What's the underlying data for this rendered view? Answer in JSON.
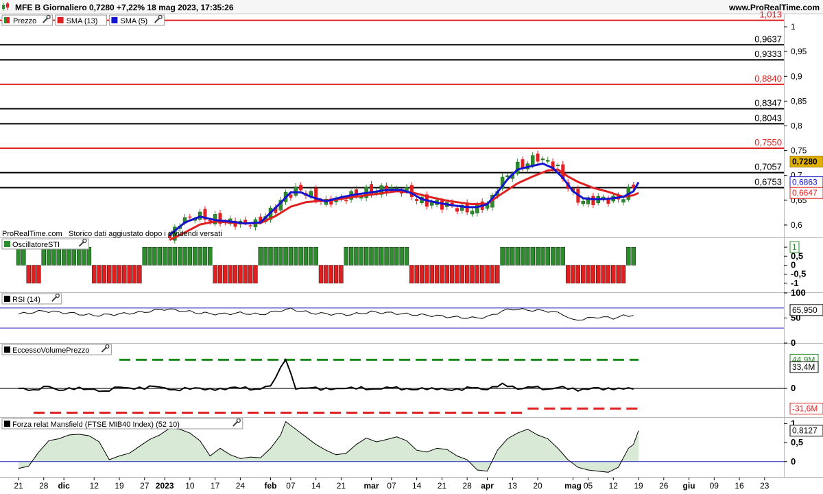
{
  "header": {
    "title": "MFE B Giornaliero 0,7280 +7,22% 18 mag 2023, 17:35:26",
    "brand": "www.ProRealTime.com"
  },
  "watermark": "ProRealTime.com",
  "note": "Storico dati aggiustato dopo i dividendi versati",
  "colors": {
    "up": "#2e8b2e",
    "down": "#e02020",
    "sma13": "#e02020",
    "sma5": "#1414d0",
    "red_level": "#e02020",
    "black_level": "#000000",
    "price_tag_bg": "#e0b000",
    "mansfield_fill": "#d8ead6"
  },
  "panels": {
    "price": {
      "legend": [
        {
          "label": "Prezzo",
          "icon": "candlestick-icon",
          "tool": true
        },
        {
          "label": "SMA (13)",
          "color": "#e02020",
          "tool": false
        },
        {
          "label": "SMA (5)",
          "color": "#1414d0",
          "tool": true
        }
      ],
      "ticks": [
        "1",
        "0,95",
        "0,9",
        "0,85",
        "0,8",
        "0,75",
        "0,7",
        "0,65",
        "0,6"
      ],
      "tick_values": [
        1,
        0.95,
        0.9,
        0.85,
        0.8,
        0.75,
        0.7,
        0.65,
        0.6
      ],
      "ylim": [
        0.575,
        1.025
      ],
      "levels": [
        {
          "value": 1.013,
          "label": "1,013",
          "color": "#e02020"
        },
        {
          "value": 0.9637,
          "label": "0,9637",
          "color": "#000000"
        },
        {
          "value": 0.9333,
          "label": "0,9333",
          "color": "#000000"
        },
        {
          "value": 0.884,
          "label": "0,8840",
          "color": "#e02020"
        },
        {
          "value": 0.8347,
          "label": "0,8347",
          "color": "#000000"
        },
        {
          "value": 0.8043,
          "label": "0,8043",
          "color": "#000000"
        },
        {
          "value": 0.755,
          "label": "0,7550",
          "color": "#e02020"
        },
        {
          "value": 0.7057,
          "label": "0,7057",
          "color": "#000000"
        },
        {
          "value": 0.6753,
          "label": "0,6753",
          "color": "#000000"
        }
      ],
      "tags": [
        {
          "value": 0.728,
          "label": "0,7280",
          "bg": "#e0b000",
          "fg": "#000000",
          "bold": true
        },
        {
          "value": 0.6863,
          "label": "0,6863",
          "bg": "#ffffff",
          "fg": "#1414d0",
          "bold": false
        },
        {
          "value": 0.6647,
          "label": "0,6647",
          "bg": "#ffffff",
          "fg": "#e02020",
          "bold": false
        }
      ]
    },
    "sti": {
      "title": "OscillatoreSTI",
      "ticks": [
        "1",
        "0,5",
        "0",
        "-0,5",
        "-1"
      ],
      "tick_values": [
        1,
        0.5,
        0,
        -0.5,
        -1
      ],
      "ylim": [
        -1.5,
        1.5
      ],
      "tag": "1"
    },
    "rsi": {
      "title": "RSI (14)",
      "ticks": [
        "100",
        "50",
        "0"
      ],
      "tick_values": [
        100,
        50,
        0
      ],
      "ylim": [
        0,
        100
      ],
      "bands": [
        70,
        30
      ],
      "tag": "65,950"
    },
    "volume": {
      "title": "EccessoVolumePrezzo",
      "ticks": [
        "0"
      ],
      "tick_values": [
        0
      ],
      "ylim": [
        -45,
        70
      ],
      "tags": [
        {
          "value": 44.9,
          "label": "44,9M",
          "fg": "#2e8b2e",
          "bg": "#ffffff"
        },
        {
          "value": 33.4,
          "label": "33,4M",
          "fg": "#000000",
          "bg": "#ffffff"
        },
        {
          "value": -31.6,
          "label": "-31,6M",
          "fg": "#e02020",
          "bg": "#ffffff"
        }
      ]
    },
    "mansfield": {
      "title": "Forza relat Mansfield (FTSE MIB40 Index) (52 10)",
      "ticks": [
        "1",
        "0,5",
        "0"
      ],
      "tick_values": [
        1,
        0.5,
        0
      ],
      "ylim": [
        -0.4,
        1.15
      ],
      "tag": "0,8127"
    }
  },
  "x_axis": {
    "labels": [
      {
        "i": 0,
        "text": "21",
        "bold": false
      },
      {
        "i": 5,
        "text": "28",
        "bold": false
      },
      {
        "i": 9,
        "text": "dic",
        "bold": true
      },
      {
        "i": 15,
        "text": "12",
        "bold": false
      },
      {
        "i": 20,
        "text": "19",
        "bold": false
      },
      {
        "i": 25,
        "text": "27",
        "bold": false
      },
      {
        "i": 29,
        "text": "2023",
        "bold": true
      },
      {
        "i": 34,
        "text": "10",
        "bold": false
      },
      {
        "i": 39,
        "text": "17",
        "bold": false
      },
      {
        "i": 44,
        "text": "24",
        "bold": false
      },
      {
        "i": 50,
        "text": "feb",
        "bold": true
      },
      {
        "i": 54,
        "text": "07",
        "bold": false
      },
      {
        "i": 59,
        "text": "14",
        "bold": false
      },
      {
        "i": 64,
        "text": "21",
        "bold": false
      },
      {
        "i": 70,
        "text": "mar",
        "bold": true
      },
      {
        "i": 74,
        "text": "07",
        "bold": false
      },
      {
        "i": 79,
        "text": "14",
        "bold": false
      },
      {
        "i": 84,
        "text": "21",
        "bold": false
      },
      {
        "i": 89,
        "text": "28",
        "bold": false
      },
      {
        "i": 93,
        "text": "apr",
        "bold": true
      },
      {
        "i": 98,
        "text": "13",
        "bold": false
      },
      {
        "i": 103,
        "text": "20",
        "bold": false
      },
      {
        "i": 110,
        "text": "mag",
        "bold": true
      },
      {
        "i": 113,
        "text": "05",
        "bold": false
      },
      {
        "i": 118,
        "text": "12",
        "bold": false
      },
      {
        "i": 123,
        "text": "19",
        "bold": false
      },
      {
        "i": 128,
        "text": "26",
        "bold": false
      },
      {
        "i": 133,
        "text": "giu",
        "bold": true
      },
      {
        "i": 138,
        "text": "09",
        "bold": false
      },
      {
        "i": 143,
        "text": "16",
        "bold": false
      },
      {
        "i": 148,
        "text": "23",
        "bold": false
      }
    ]
  },
  "chart_data": {
    "type": "candlestick",
    "title": "MFE B Giornaliero",
    "series_names": [
      "Prezzo",
      "SMA (13)",
      "SMA (5)"
    ],
    "x_start_label": "21",
    "bar_count": 123,
    "close_points": [
      [
        30,
        0.575
      ],
      [
        32,
        0.605
      ],
      [
        35,
        0.618
      ],
      [
        37,
        0.613
      ],
      [
        40,
        0.608
      ],
      [
        42,
        0.604
      ],
      [
        45,
        0.603
      ],
      [
        47,
        0.604
      ],
      [
        49,
        0.62
      ],
      [
        51,
        0.635
      ],
      [
        53,
        0.662
      ],
      [
        55,
        0.672
      ],
      [
        57,
        0.668
      ],
      [
        59,
        0.654
      ],
      [
        61,
        0.646
      ],
      [
        63,
        0.65
      ],
      [
        65,
        0.655
      ],
      [
        67,
        0.66
      ],
      [
        69,
        0.665
      ],
      [
        71,
        0.668
      ],
      [
        73,
        0.672
      ],
      [
        75,
        0.671
      ],
      [
        77,
        0.669
      ],
      [
        79,
        0.652
      ],
      [
        81,
        0.647
      ],
      [
        83,
        0.645
      ],
      [
        85,
        0.641
      ],
      [
        87,
        0.637
      ],
      [
        89,
        0.629
      ],
      [
        91,
        0.636
      ],
      [
        93,
        0.638
      ],
      [
        95,
        0.675
      ],
      [
        97,
        0.7
      ],
      [
        99,
        0.715
      ],
      [
        101,
        0.725
      ],
      [
        103,
        0.735
      ],
      [
        105,
        0.726
      ],
      [
        107,
        0.715
      ],
      [
        108,
        0.695
      ],
      [
        110,
        0.66
      ],
      [
        112,
        0.648
      ],
      [
        114,
        0.652
      ],
      [
        116,
        0.655
      ],
      [
        118,
        0.652
      ],
      [
        120,
        0.657
      ],
      [
        122,
        0.68
      ],
      [
        123,
        0.728
      ]
    ],
    "sma13_points": [
      [
        30,
        0.57
      ],
      [
        33,
        0.585
      ],
      [
        36,
        0.601
      ],
      [
        39,
        0.607
      ],
      [
        42,
        0.605
      ],
      [
        45,
        0.603
      ],
      [
        48,
        0.604
      ],
      [
        51,
        0.618
      ],
      [
        54,
        0.637
      ],
      [
        57,
        0.646
      ],
      [
        60,
        0.649
      ],
      [
        63,
        0.651
      ],
      [
        66,
        0.656
      ],
      [
        69,
        0.66
      ],
      [
        72,
        0.664
      ],
      [
        75,
        0.668
      ],
      [
        78,
        0.666
      ],
      [
        81,
        0.658
      ],
      [
        84,
        0.651
      ],
      [
        87,
        0.646
      ],
      [
        90,
        0.642
      ],
      [
        93,
        0.643
      ],
      [
        96,
        0.664
      ],
      [
        99,
        0.684
      ],
      [
        102,
        0.698
      ],
      [
        105,
        0.71
      ],
      [
        107,
        0.712
      ],
      [
        109,
        0.698
      ],
      [
        111,
        0.687
      ],
      [
        114,
        0.675
      ],
      [
        117,
        0.667
      ],
      [
        120,
        0.657
      ],
      [
        122,
        0.66
      ],
      [
        123,
        0.6647
      ]
    ],
    "sma5_points": [
      [
        30,
        0.58
      ],
      [
        33,
        0.605
      ],
      [
        36,
        0.617
      ],
      [
        39,
        0.61
      ],
      [
        42,
        0.607
      ],
      [
        45,
        0.603
      ],
      [
        48,
        0.605
      ],
      [
        50,
        0.625
      ],
      [
        52,
        0.645
      ],
      [
        54,
        0.666
      ],
      [
        56,
        0.666
      ],
      [
        58,
        0.657
      ],
      [
        61,
        0.648
      ],
      [
        64,
        0.656
      ],
      [
        67,
        0.662
      ],
      [
        70,
        0.666
      ],
      [
        73,
        0.671
      ],
      [
        76,
        0.671
      ],
      [
        78,
        0.664
      ],
      [
        80,
        0.652
      ],
      [
        83,
        0.645
      ],
      [
        86,
        0.64
      ],
      [
        89,
        0.636
      ],
      [
        91,
        0.636
      ],
      [
        93,
        0.642
      ],
      [
        95,
        0.666
      ],
      [
        97,
        0.692
      ],
      [
        99,
        0.712
      ],
      [
        101,
        0.717
      ],
      [
        104,
        0.724
      ],
      [
        106,
        0.715
      ],
      [
        108,
        0.695
      ],
      [
        110,
        0.668
      ],
      [
        112,
        0.654
      ],
      [
        114,
        0.652
      ],
      [
        116,
        0.652
      ],
      [
        118,
        0.654
      ],
      [
        120,
        0.657
      ],
      [
        122,
        0.668
      ],
      [
        123,
        0.6863
      ]
    ],
    "sti_states": [
      [
        0,
        1
      ],
      [
        2,
        -1
      ],
      [
        5,
        1
      ],
      [
        15,
        -1
      ],
      [
        25,
        1
      ],
      [
        39,
        -1
      ],
      [
        48,
        1
      ],
      [
        60,
        -1
      ],
      [
        65,
        1
      ],
      [
        78,
        -1
      ],
      [
        96,
        1
      ],
      [
        109,
        -1
      ],
      [
        121,
        1
      ],
      [
        123,
        1
      ]
    ],
    "rsi_points": [
      [
        0,
        58
      ],
      [
        5,
        64
      ],
      [
        10,
        60
      ],
      [
        15,
        55
      ],
      [
        20,
        58
      ],
      [
        25,
        62
      ],
      [
        29,
        68
      ],
      [
        32,
        65
      ],
      [
        36,
        60
      ],
      [
        40,
        58
      ],
      [
        44,
        60
      ],
      [
        48,
        57
      ],
      [
        52,
        65
      ],
      [
        54,
        68
      ],
      [
        58,
        60
      ],
      [
        62,
        58
      ],
      [
        66,
        57
      ],
      [
        70,
        62
      ],
      [
        74,
        60
      ],
      [
        78,
        57
      ],
      [
        82,
        55
      ],
      [
        86,
        52
      ],
      [
        90,
        50
      ],
      [
        93,
        52
      ],
      [
        96,
        64
      ],
      [
        98,
        68
      ],
      [
        101,
        66
      ],
      [
        105,
        64
      ],
      [
        108,
        58
      ],
      [
        110,
        45
      ],
      [
        112,
        48
      ],
      [
        115,
        52
      ],
      [
        118,
        50
      ],
      [
        120,
        54
      ],
      [
        122,
        55
      ],
      [
        123,
        65.95
      ]
    ],
    "volume_points": [
      [
        0,
        0
      ],
      [
        3,
        -2
      ],
      [
        6,
        3
      ],
      [
        8,
        -3
      ],
      [
        10,
        1
      ],
      [
        14,
        -1
      ],
      [
        17,
        -4
      ],
      [
        20,
        2
      ],
      [
        23,
        -1
      ],
      [
        27,
        3
      ],
      [
        31,
        -2
      ],
      [
        35,
        1
      ],
      [
        39,
        -3
      ],
      [
        43,
        2
      ],
      [
        47,
        -1
      ],
      [
        50,
        4
      ],
      [
        53,
        45
      ],
      [
        55,
        -1
      ],
      [
        58,
        1
      ],
      [
        62,
        -2
      ],
      [
        66,
        2
      ],
      [
        70,
        -1
      ],
      [
        74,
        1
      ],
      [
        78,
        -2
      ],
      [
        82,
        1
      ],
      [
        86,
        -3
      ],
      [
        90,
        1
      ],
      [
        93,
        -2
      ],
      [
        96,
        8
      ],
      [
        99,
        -1
      ],
      [
        102,
        2
      ],
      [
        105,
        -1
      ],
      [
        108,
        3
      ],
      [
        111,
        -4
      ],
      [
        114,
        1
      ],
      [
        118,
        -2
      ],
      [
        121,
        1
      ],
      [
        122,
        -1
      ],
      [
        123,
        33.4
      ]
    ],
    "volume_upper_band": [
      [
        20,
        44.9
      ],
      [
        123,
        44.9
      ]
    ],
    "volume_lower_band": [
      [
        3,
        -38
      ],
      [
        100,
        -38
      ],
      [
        101,
        -31.6
      ],
      [
        123,
        -31.6
      ]
    ],
    "mansfield_points": [
      [
        0,
        -0.18
      ],
      [
        2,
        -0.12
      ],
      [
        4,
        0.25
      ],
      [
        6,
        0.55
      ],
      [
        8,
        0.6
      ],
      [
        10,
        0.7
      ],
      [
        12,
        0.72
      ],
      [
        14,
        0.68
      ],
      [
        16,
        0.52
      ],
      [
        18,
        0.05
      ],
      [
        20,
        0.15
      ],
      [
        22,
        0.22
      ],
      [
        24,
        0.4
      ],
      [
        26,
        0.58
      ],
      [
        28,
        0.7
      ],
      [
        30,
        0.88
      ],
      [
        32,
        0.85
      ],
      [
        34,
        0.75
      ],
      [
        36,
        0.55
      ],
      [
        38,
        0.15
      ],
      [
        40,
        0.35
      ],
      [
        42,
        0.18
      ],
      [
        44,
        0.08
      ],
      [
        46,
        0.12
      ],
      [
        48,
        0.1
      ],
      [
        50,
        0.35
      ],
      [
        52,
        0.7
      ],
      [
        53,
        1.05
      ],
      [
        55,
        0.85
      ],
      [
        57,
        0.65
      ],
      [
        59,
        0.45
      ],
      [
        61,
        0.3
      ],
      [
        63,
        0.18
      ],
      [
        65,
        0.22
      ],
      [
        67,
        0.45
      ],
      [
        69,
        0.62
      ],
      [
        71,
        0.52
      ],
      [
        73,
        0.58
      ],
      [
        75,
        0.65
      ],
      [
        77,
        0.55
      ],
      [
        79,
        0.3
      ],
      [
        81,
        0.25
      ],
      [
        83,
        0.35
      ],
      [
        85,
        0.32
      ],
      [
        87,
        0.15
      ],
      [
        89,
        0.05
      ],
      [
        91,
        -0.22
      ],
      [
        93,
        -0.25
      ],
      [
        95,
        0.3
      ],
      [
        97,
        0.6
      ],
      [
        99,
        0.75
      ],
      [
        101,
        0.85
      ],
      [
        103,
        0.7
      ],
      [
        105,
        0.6
      ],
      [
        107,
        0.35
      ],
      [
        109,
        0.05
      ],
      [
        111,
        -0.15
      ],
      [
        113,
        -0.22
      ],
      [
        115,
        -0.25
      ],
      [
        117,
        -0.28
      ],
      [
        119,
        -0.15
      ],
      [
        121,
        0.35
      ],
      [
        122,
        0.45
      ],
      [
        123,
        0.8127
      ]
    ]
  }
}
